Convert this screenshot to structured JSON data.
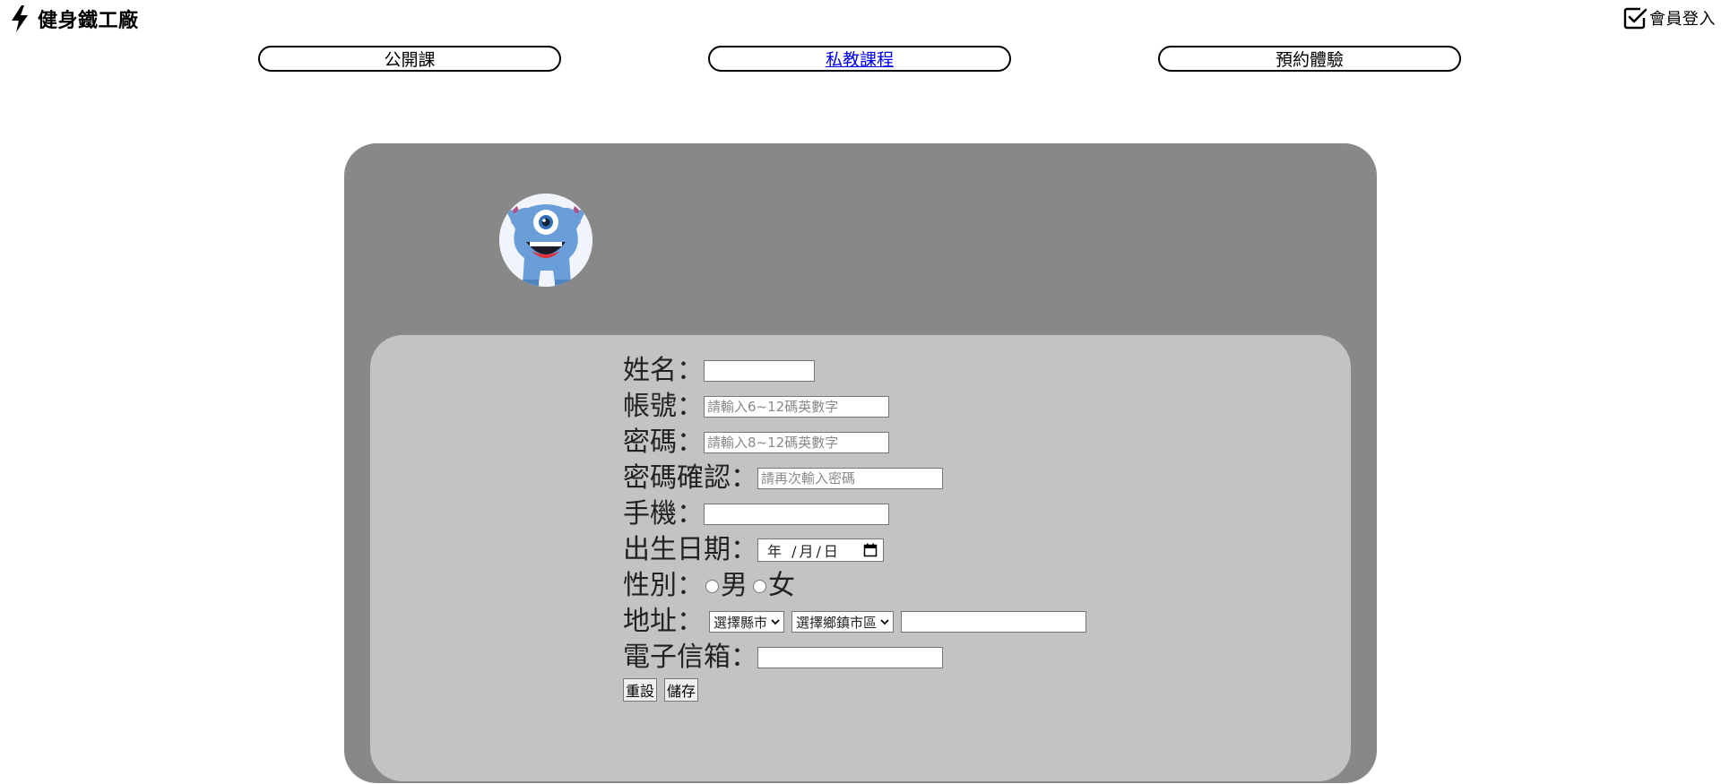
{
  "header": {
    "brand_icon": "lightning-bolt-icon",
    "brand_name": "健身鐵工廠",
    "login_icon": "checkbox-checked-icon",
    "login_label": "會員登入"
  },
  "nav": {
    "items": [
      {
        "label": "公開課",
        "style": "plain"
      },
      {
        "label": "私教課程",
        "style": "link"
      },
      {
        "label": "預約體驗",
        "style": "plain"
      }
    ]
  },
  "profile": {
    "avatar_icon": "blue-monster-avatar-icon"
  },
  "form": {
    "name_label": "姓名：",
    "name_value": "",
    "account_label": "帳號：",
    "account_placeholder": "請輸入6~12碼英數字",
    "password_label": "密碼：",
    "password_placeholder": "請輸入8~12碼英數字",
    "confirm_label": "密碼確認：",
    "confirm_placeholder": "請再次輸入密碼",
    "phone_label": "手機：",
    "phone_value": "",
    "birth_label": "出生日期：",
    "birth_display": "年 /月/日",
    "gender_label": "性別：",
    "gender_options": [
      "男",
      "女"
    ],
    "address_label": "地址：",
    "city_select": "選擇縣市",
    "district_select": "選擇鄉鎮市區",
    "address_value": "",
    "email_label": "電子信箱：",
    "email_value": "",
    "reset_label": "重設",
    "save_label": "儲存"
  },
  "colors": {
    "card_bg": "#888888",
    "panel_bg": "#c3c3c3",
    "link": "#0000ee"
  }
}
